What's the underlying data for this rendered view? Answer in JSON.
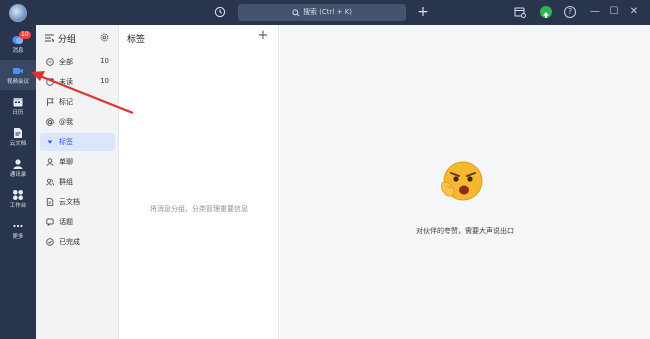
{
  "titlebar": {
    "search_placeholder": "搜索 (Ctrl + K)",
    "add_label": "+",
    "minimize": "—",
    "maximize": "☐",
    "close": "✕"
  },
  "nav": {
    "items": [
      {
        "label": "消息",
        "badge": "10",
        "icon": "message-icon"
      },
      {
        "label": "视频会议",
        "icon": "video-meeting-icon"
      },
      {
        "label": "日历",
        "icon": "calendar-icon"
      },
      {
        "label": "云文档",
        "icon": "cloud-doc-icon"
      },
      {
        "label": "通讯录",
        "icon": "contacts-icon"
      },
      {
        "label": "工作台",
        "icon": "workbench-icon"
      },
      {
        "label": "更多",
        "icon": "more-icon"
      }
    ]
  },
  "groups": {
    "title": "分组",
    "items": [
      {
        "label": "全部",
        "count": "10",
        "icon": "chat-icon"
      },
      {
        "label": "未读",
        "count": "10",
        "icon": "unread-icon"
      },
      {
        "label": "标记",
        "count": "",
        "icon": "flag-icon"
      },
      {
        "label": "@我",
        "count": "",
        "icon": "at-icon"
      },
      {
        "label": "标签",
        "count": "",
        "icon": "caret-down-icon"
      },
      {
        "label": "单聊",
        "count": "",
        "icon": "person-icon"
      },
      {
        "label": "群组",
        "count": "",
        "icon": "group-icon"
      },
      {
        "label": "云文档",
        "count": "",
        "icon": "document-icon"
      },
      {
        "label": "话题",
        "count": "",
        "icon": "topic-icon"
      },
      {
        "label": "已完成",
        "count": "",
        "icon": "check-circle-icon"
      }
    ]
  },
  "tags": {
    "title": "标签",
    "add_label": "+",
    "empty_text": "将消息分组，分类管理重要信息"
  },
  "main": {
    "message": "对伙伴的夸赞，需要大声说出口"
  },
  "colors": {
    "titlebar": "#29354d",
    "badge": "#f2443b",
    "accent": "#2a5fd6",
    "arrow": "#e0332e"
  }
}
